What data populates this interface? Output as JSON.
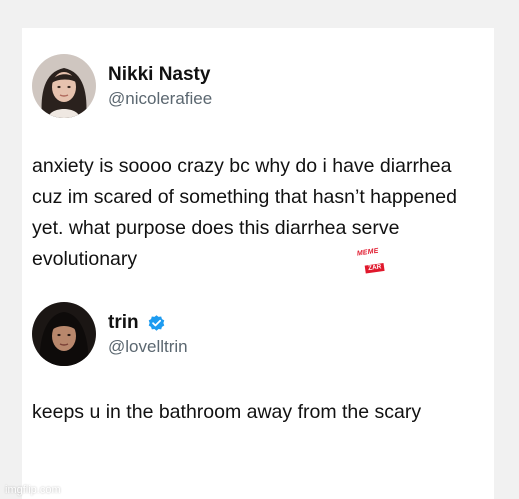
{
  "posts": [
    {
      "display_name": "Nikki Nasty",
      "handle": "@nicolerafiee",
      "verified": false,
      "text": "anxiety is soooo crazy bc why do i have diarrhea cuz im scared of something that hasn’t happened yet. what purpose does this diarrhea serve evolutionary"
    },
    {
      "display_name": "trin",
      "handle": "@lovelltrin",
      "verified": true,
      "text": "keeps u in the bathroom away from the scary"
    }
  ],
  "watermark": {
    "top": "MEME",
    "bottom": "ZAR"
  },
  "site_credit": "imgflip.com",
  "colors": {
    "verified_badge": "#1d9bf0",
    "watermark_red": "#e0182c",
    "handle_gray": "#5b6770"
  }
}
